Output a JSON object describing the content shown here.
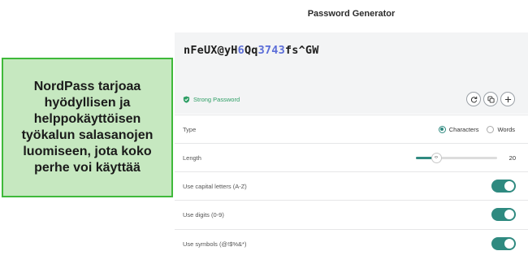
{
  "window": {
    "title": "Password Generator"
  },
  "password": {
    "segments": [
      {
        "text": "nFeUX@yH",
        "kind": "char"
      },
      {
        "text": "6",
        "kind": "digit"
      },
      {
        "text": "Qq",
        "kind": "char"
      },
      {
        "text": "3743",
        "kind": "digit"
      },
      {
        "text": "fs^GW",
        "kind": "char"
      }
    ],
    "strength": "Strong Password",
    "strength_color": "#2e9e65",
    "digit_color": "#5b6dd8",
    "actions": [
      {
        "name": "regenerate",
        "icon": "refresh-icon"
      },
      {
        "name": "copy",
        "icon": "copy-icon"
      },
      {
        "name": "add",
        "icon": "plus-icon"
      }
    ]
  },
  "settings": {
    "type": {
      "label": "Type",
      "options": [
        "Characters",
        "Words"
      ],
      "selected": "Characters"
    },
    "length": {
      "label": "Length",
      "value": "20",
      "fraction": 0.25
    },
    "toggles": [
      {
        "label": "Use capital letters (A-Z)",
        "on": true
      },
      {
        "label": "Use digits (0-9)",
        "on": true
      },
      {
        "label": "Use symbols (@!$%&*)",
        "on": true
      }
    ]
  },
  "callout": {
    "text": "NordPass tarjoaa hyödyllisen ja helppokäyttöisen työkalun salasanojen luomiseen, jota koko perhe voi käyttää"
  },
  "colors": {
    "accent": "#2f8a80",
    "callout_bg": "#c6e8c0",
    "callout_border": "#3fb93a"
  }
}
